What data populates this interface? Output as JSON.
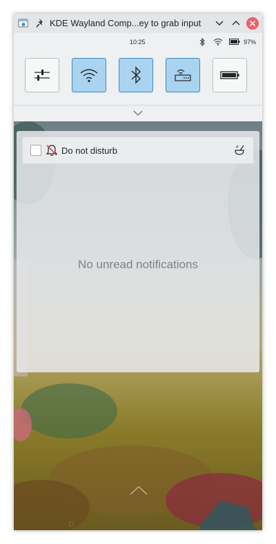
{
  "window": {
    "title": "KDE Wayland Comp...ey to grab input",
    "icons": [
      "window-app-icon",
      "pin-icon",
      "minimize-chevron-icon",
      "maximize-chevron-icon",
      "close-icon"
    ]
  },
  "statusbar": {
    "time": "10:25",
    "battery": "97%",
    "icons": [
      "bluetooth-icon",
      "wifi-icon",
      "battery-icon"
    ]
  },
  "quick_settings": [
    {
      "name": "settings",
      "icon": "sliders-icon",
      "active": false
    },
    {
      "name": "wifi",
      "icon": "wifi-icon",
      "active": true
    },
    {
      "name": "bluetooth",
      "icon": "bluetooth-icon",
      "active": true
    },
    {
      "name": "mobile-data",
      "icon": "router-icon",
      "active": true
    },
    {
      "name": "battery",
      "icon": "battery-icon",
      "active": false
    }
  ],
  "notifications": {
    "dnd_label": "Do not disturb",
    "dnd_checked": false,
    "empty_message": "No unread notifications"
  },
  "colors": {
    "toggle_active_bg": "#a9d3ef",
    "toggle_active_border": "#3a8cc4",
    "close_button": "#ed5f6e"
  }
}
